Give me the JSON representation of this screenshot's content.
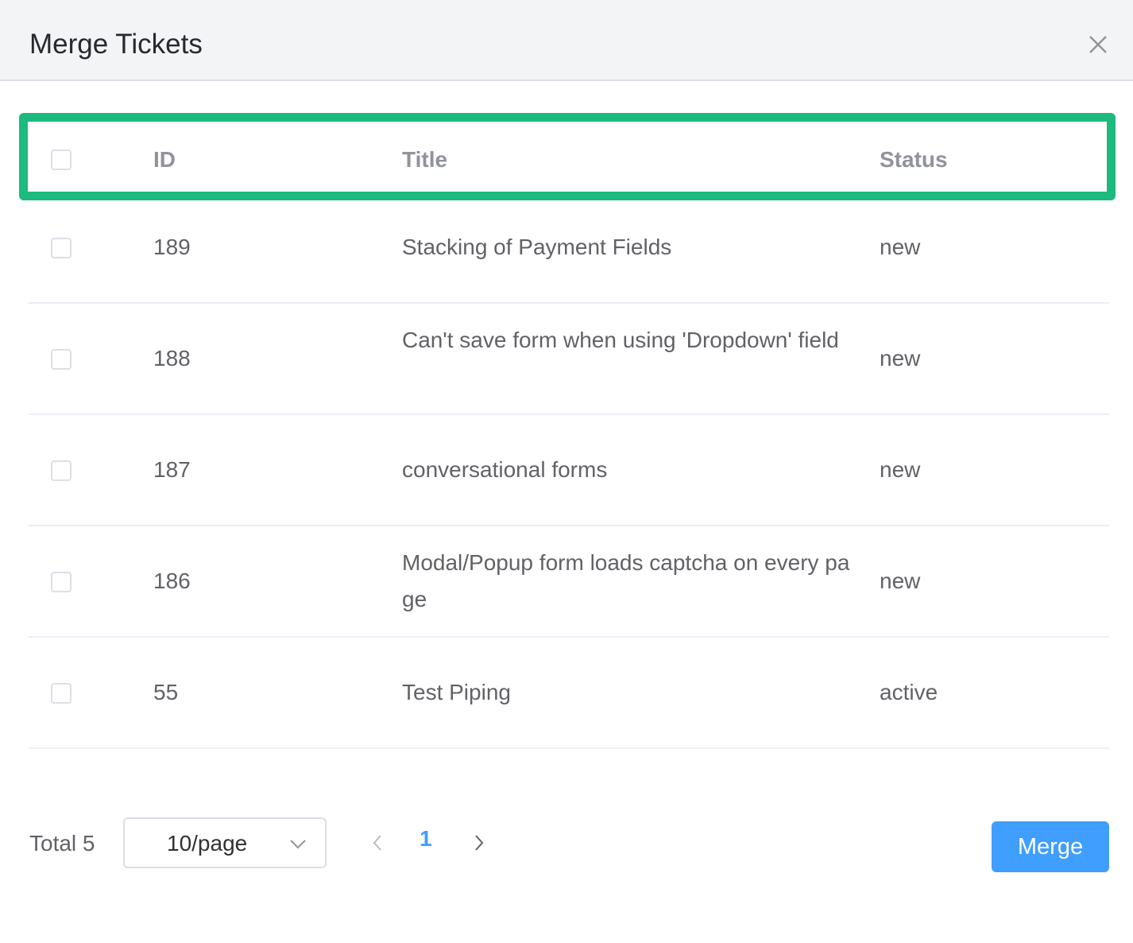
{
  "dialog": {
    "title": "Merge Tickets"
  },
  "table": {
    "columns": {
      "id": "ID",
      "title": "Title",
      "status": "Status"
    },
    "rows": [
      {
        "id": "189",
        "title": "Stacking of Payment Fields",
        "status": "new"
      },
      {
        "id": "188",
        "title": "Can't save form when using 'Dropdown' field",
        "status": "new"
      },
      {
        "id": "187",
        "title": "conversational forms",
        "status": "new"
      },
      {
        "id": "186",
        "title": "Modal/Popup form loads captcha on every page",
        "status": "new"
      },
      {
        "id": "55",
        "title": "Test Piping",
        "status": "active"
      }
    ]
  },
  "pagination": {
    "total_label": "Total 5",
    "page_size": "10/page",
    "current_page": "1"
  },
  "actions": {
    "merge_label": "Merge"
  },
  "colors": {
    "accent": "#409eff",
    "highlight": "#1cba7e"
  }
}
